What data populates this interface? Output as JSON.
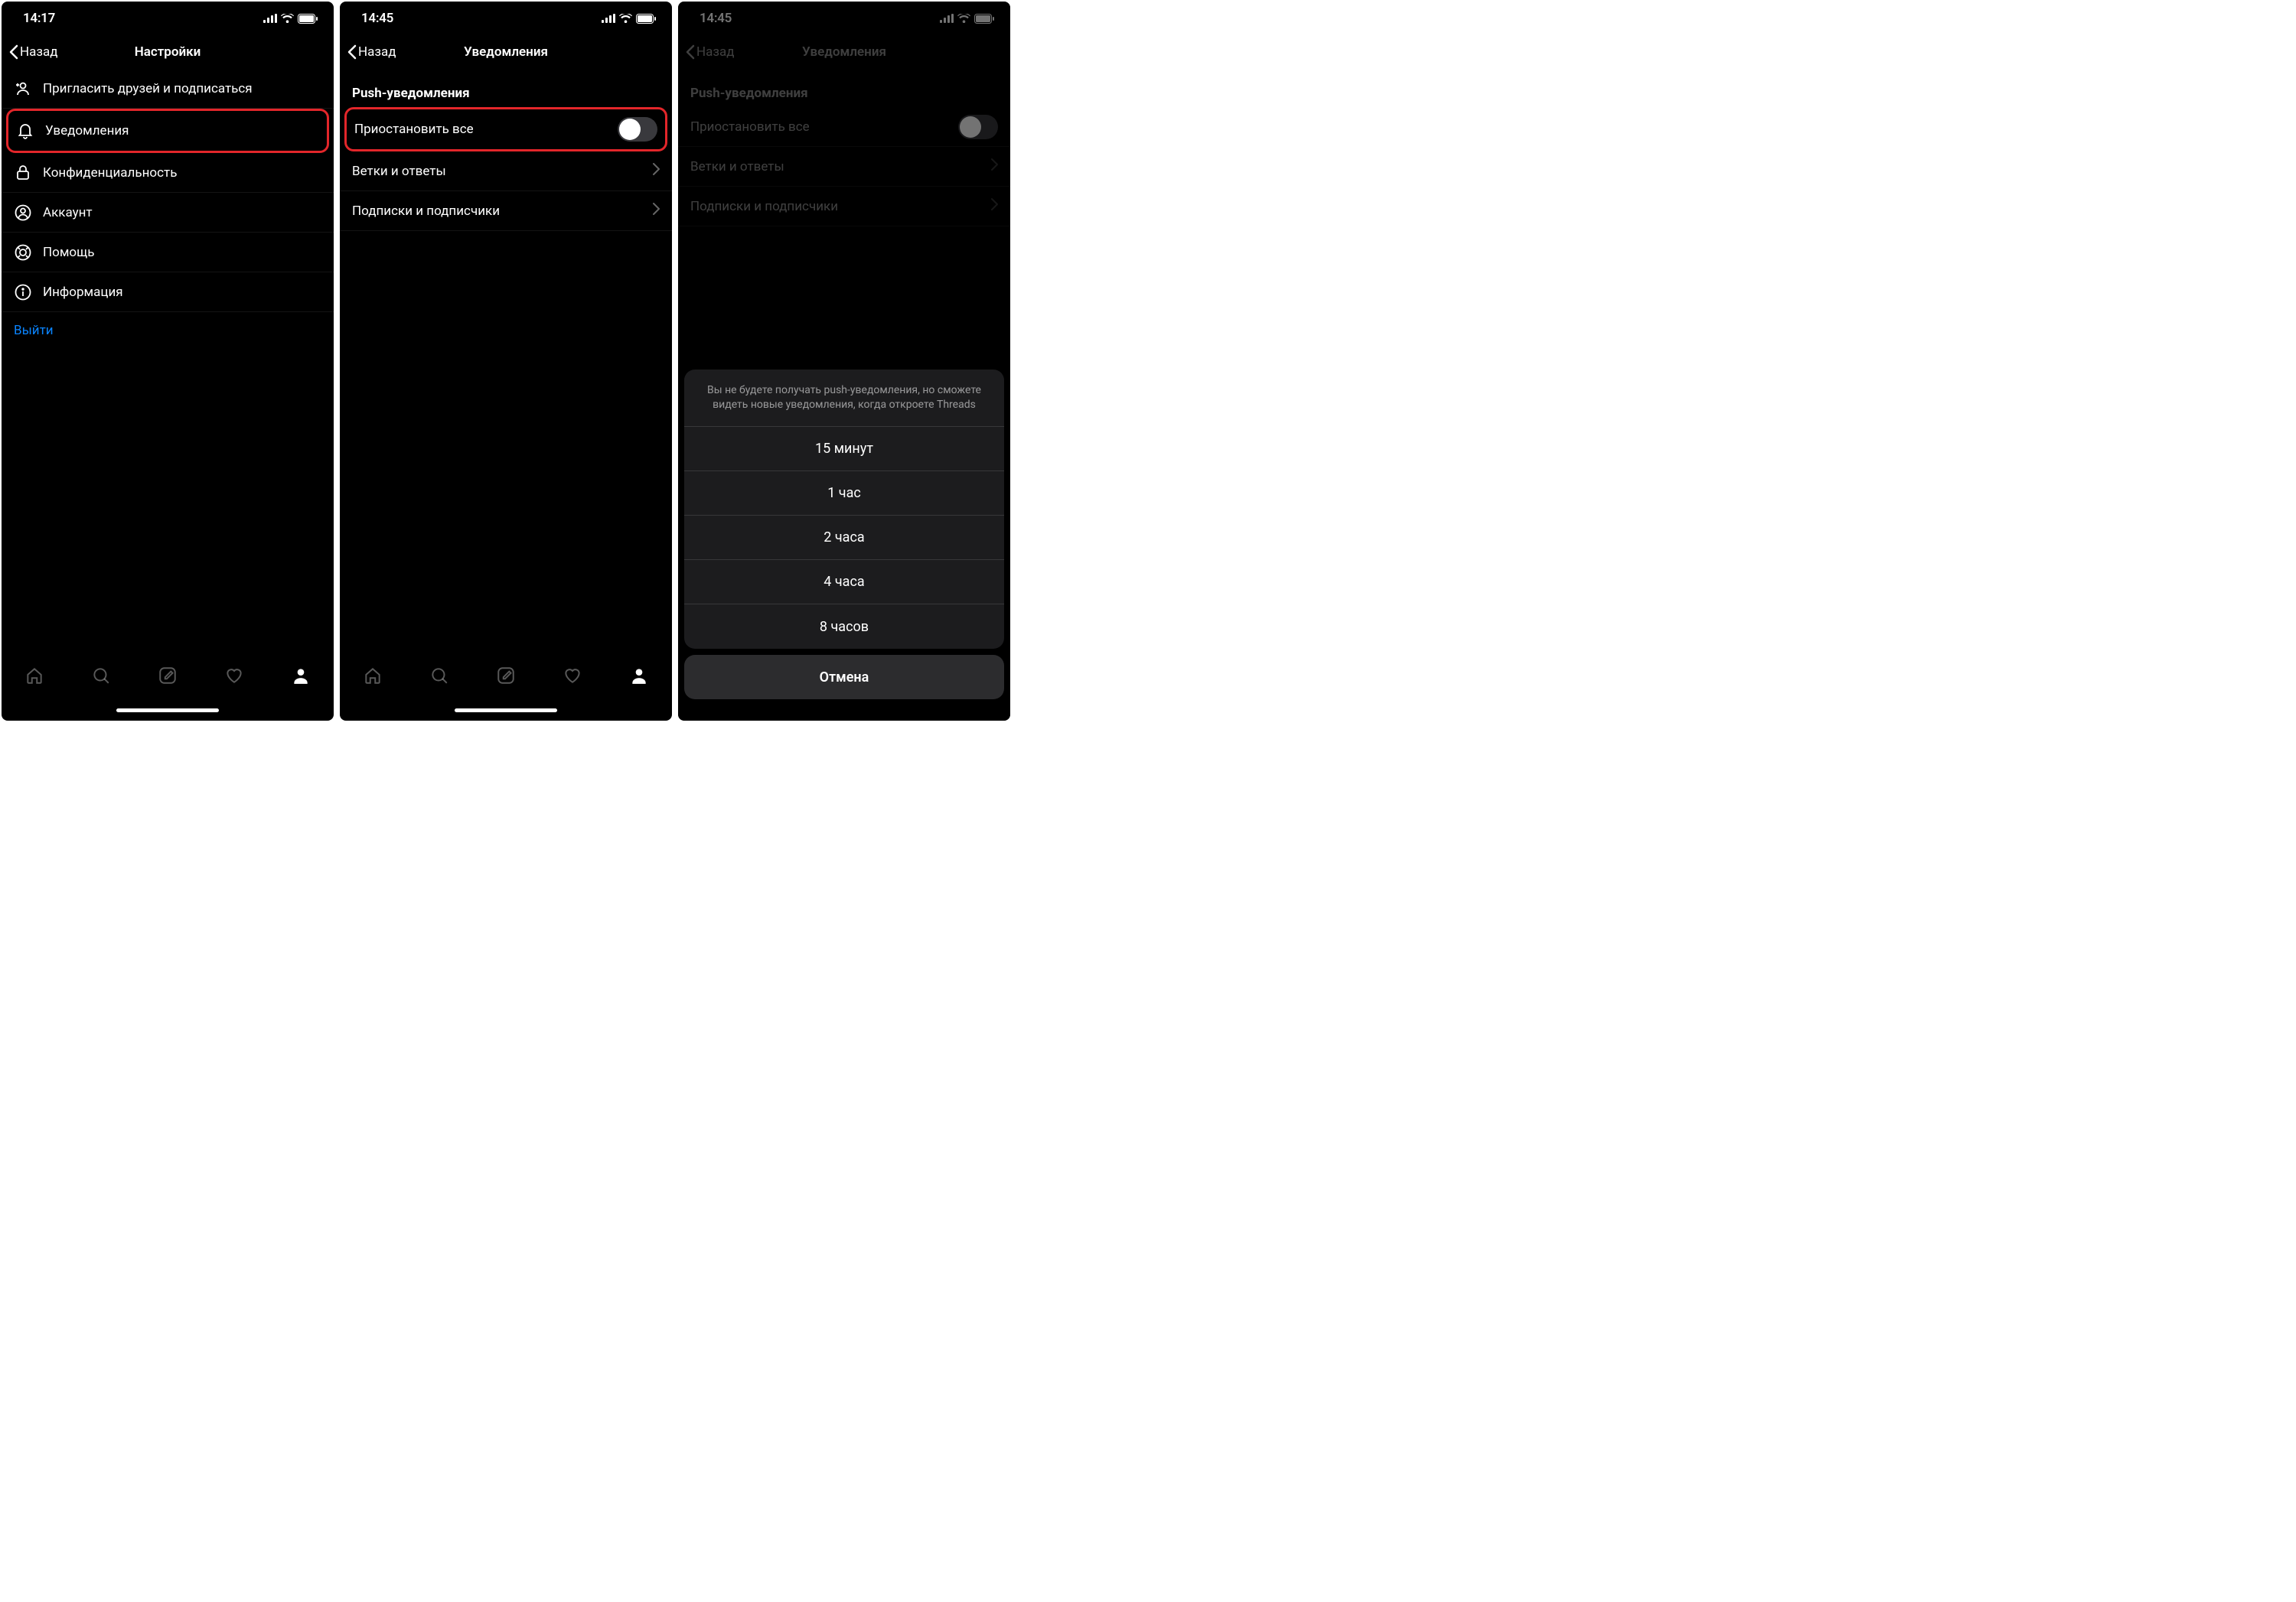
{
  "screen1": {
    "status_time": "14:17",
    "back_label": "Назад",
    "title": "Настройки",
    "rows": {
      "invite": "Пригласить друзей и подписаться",
      "notifications": "Уведомления",
      "privacy": "Конфиденциальность",
      "account": "Аккаунт",
      "help": "Помощь",
      "about": "Информация"
    },
    "logout": "Выйти"
  },
  "screen2": {
    "status_time": "14:45",
    "back_label": "Назад",
    "title": "Уведомления",
    "section": "Push-уведомления",
    "rows": {
      "pause_all": "Приостановить все",
      "threads_replies": "Ветки и ответы",
      "following_followers": "Подписки и подписчики"
    }
  },
  "screen3": {
    "status_time": "14:45",
    "back_label": "Назад",
    "title": "Уведомления",
    "section": "Push-уведомления",
    "rows": {
      "pause_all": "Приостановить все",
      "threads_replies": "Ветки и ответы",
      "following_followers": "Подписки и подписчики"
    },
    "sheet": {
      "header": "Вы не будете получать push-уведомления, но сможете видеть новые уведомления, когда откроете Threads",
      "options": {
        "o1": "15 минут",
        "o2": "1 час",
        "o3": "2 часа",
        "o4": "4 часа",
        "o5": "8 часов"
      },
      "cancel": "Отмена"
    }
  }
}
